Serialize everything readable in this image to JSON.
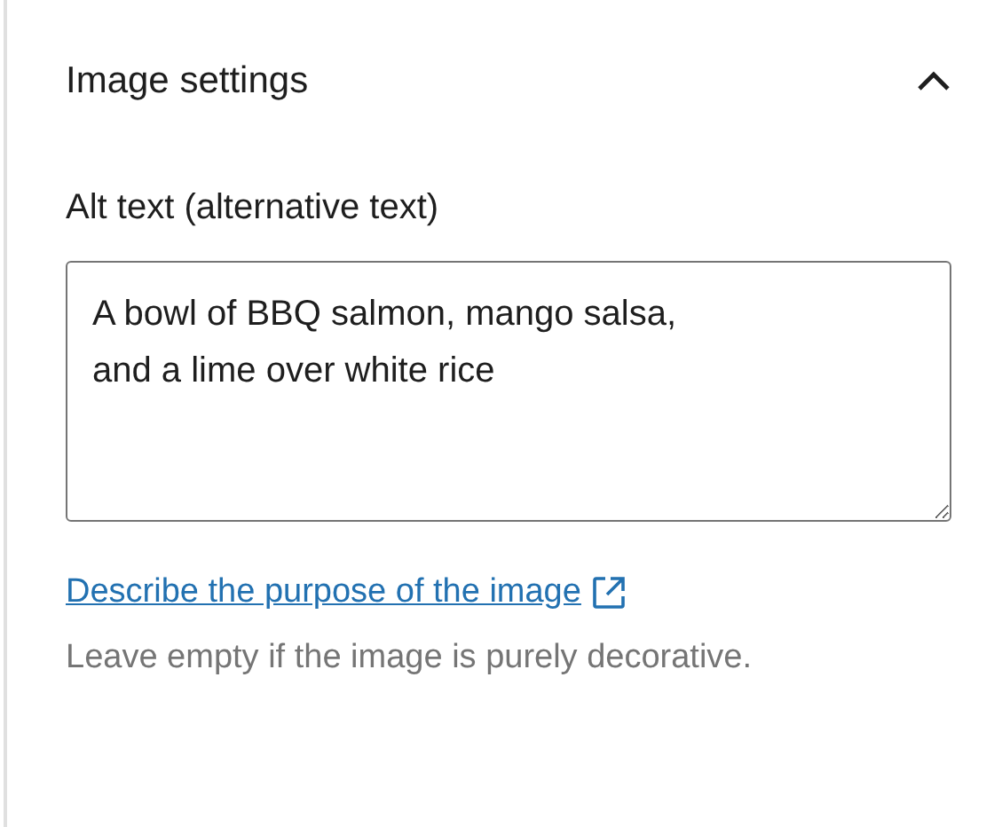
{
  "panel": {
    "title": "Image settings",
    "expanded": true
  },
  "alt_field": {
    "label": "Alt text (alternative text)",
    "value": "A bowl of BBQ salmon, mango salsa, and a lime over white rice"
  },
  "help_link": {
    "text": "Describe the purpose of the image"
  },
  "help_text": "Leave empty if the image is purely decorative."
}
